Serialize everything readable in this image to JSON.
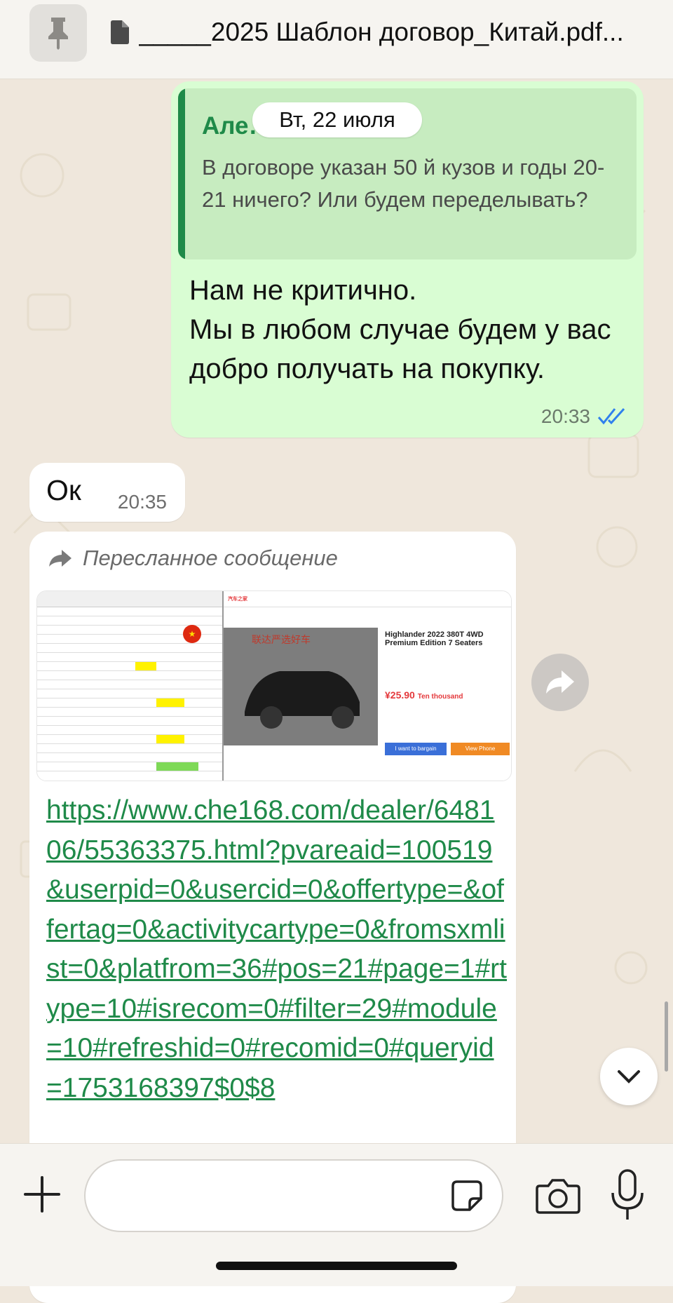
{
  "pinned": {
    "title": "_____2025 Шаблон договор_Китай.pdf..."
  },
  "date_label": "Вт, 22 июля",
  "outgoing": {
    "quote_author": "Але…й…ов",
    "quote_text": "В договоре указан 50 й кузов и годы 20-21 ничего? Или будем переделывать?",
    "text": "Нам не критично.\nМы в любом случае будем у вас добро получать на покупку.",
    "time": "20:33"
  },
  "incoming_ok": {
    "text": "Ок",
    "time": "20:35"
  },
  "forwarded": {
    "label": "Пересланное сообщение",
    "preview": {
      "car_title": "Highlander 2022 380T 4WD Premium Edition 7 Seaters",
      "price": "¥25.90",
      "price_unit": "Ten thousand",
      "bargain_label": "I want to bargain",
      "phone_label": "View Phone"
    },
    "link": "https://www.che168.com/dealer/648106/55363375.html?pvareaid=100519&userpid=0&usercid=0&offertype=&offertag=0&activitycartype=0&fromsxmlist=0&platfrom=36#pos=21#page=1#rtype=10#isrecom=0#filter=29#module=10#refreshid=0#recomid=0#queryid=1753168397$0$8"
  },
  "composer": {
    "placeholder": ""
  },
  "colors": {
    "outgoing_bubble": "#d9fdd3",
    "link_green": "#1f8a49",
    "read_ticks": "#2f80ed"
  },
  "icons": [
    "pin-icon",
    "document-icon",
    "read-ticks-icon",
    "forward-arrow-icon",
    "share-forward-icon",
    "chevron-down-icon",
    "plus-icon",
    "sticker-icon",
    "camera-icon",
    "microphone-icon"
  ]
}
